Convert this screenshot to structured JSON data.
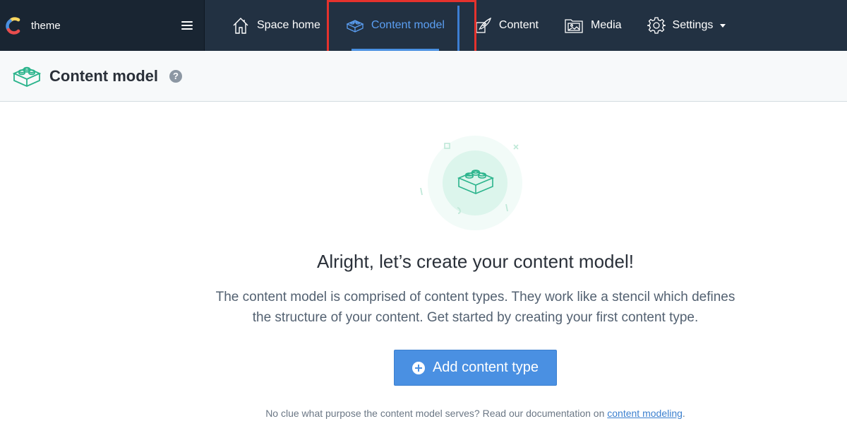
{
  "space": {
    "name": "theme"
  },
  "nav": {
    "items": [
      {
        "label": "Space home",
        "icon": "house-icon"
      },
      {
        "label": "Content model",
        "icon": "lego-brick-icon"
      },
      {
        "label": "Content",
        "icon": "feather-pen-icon"
      },
      {
        "label": "Media",
        "icon": "image-folder-icon"
      },
      {
        "label": "Settings",
        "icon": "gear-icon"
      }
    ],
    "active": "Content model"
  },
  "page": {
    "title": "Content model",
    "help_label": "?"
  },
  "empty_state": {
    "heading": "Alright, let’s create your content model!",
    "description": "The content model is comprised of content types. They work like a stencil which defines the structure of your content. Get started by creating your first content type.",
    "button_label": "Add content type",
    "footer_prefix": "No clue what purpose the content model serves? Read our documentation on ",
    "footer_link": "content modeling",
    "footer_suffix": "."
  },
  "colors": {
    "topbar": "#223142",
    "space_switcher": "#192532",
    "accent": "#4a90e2",
    "highlight": "#e5322d",
    "illustration_green": "#2bb48c"
  }
}
